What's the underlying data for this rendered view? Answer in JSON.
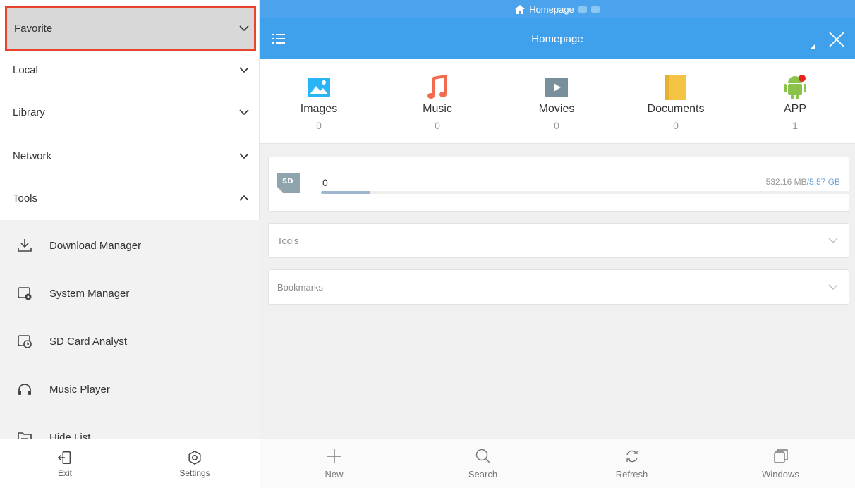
{
  "drawer": {
    "sections": [
      {
        "label": "Favorite",
        "state": "collapsed",
        "icon": "chevron-down-icon",
        "highlighted": true
      },
      {
        "label": "Local",
        "state": "collapsed",
        "icon": "chevron-down-icon"
      },
      {
        "label": "Library",
        "state": "collapsed",
        "icon": "chevron-down-icon"
      },
      {
        "label": "Network",
        "state": "collapsed",
        "icon": "chevron-down-icon"
      },
      {
        "label": "Tools",
        "state": "expanded",
        "icon": "chevron-up-icon"
      }
    ],
    "tools": [
      {
        "label": "Download Manager",
        "icon": "download-icon"
      },
      {
        "label": "System Manager",
        "icon": "system-manager-icon"
      },
      {
        "label": "SD Card Analyst",
        "icon": "sd-analyst-icon"
      },
      {
        "label": "Music Player",
        "icon": "headphones-icon"
      },
      {
        "label": "Hide List",
        "icon": "hide-list-icon"
      }
    ],
    "bottom": {
      "exit_label": "Exit",
      "settings_label": "Settings"
    }
  },
  "main": {
    "status_bar": {
      "label": "Homepage",
      "icon": "home-icon"
    },
    "toolbar": {
      "title": "Homepage"
    },
    "categories": [
      {
        "name": "Images",
        "count": "0",
        "icon": "images-icon",
        "color": "#29b6f6"
      },
      {
        "name": "Music",
        "count": "0",
        "icon": "music-icon",
        "color": "#f26b4f"
      },
      {
        "name": "Movies",
        "count": "0",
        "icon": "movies-icon",
        "color": "#78909c"
      },
      {
        "name": "Documents",
        "count": "0",
        "icon": "documents-icon",
        "color": "#f5c344"
      },
      {
        "name": "APP",
        "count": "1",
        "icon": "android-icon",
        "color": "#8bc34a",
        "badge": true
      }
    ],
    "storage": {
      "name": "0",
      "used": "532.16 MB",
      "total": "/5.57 GB",
      "used_fraction": 0.093
    },
    "panels": {
      "tools_label": "Tools",
      "bookmarks_label": "Bookmarks"
    },
    "bottom_nav": {
      "new_label": "New",
      "search_label": "Search",
      "refresh_label": "Refresh",
      "windows_label": "Windows"
    }
  },
  "colors": {
    "toolbar": "#3fa0ec",
    "highlight_border": "#e8432c",
    "highlight_fill": "#d8d8d8"
  }
}
